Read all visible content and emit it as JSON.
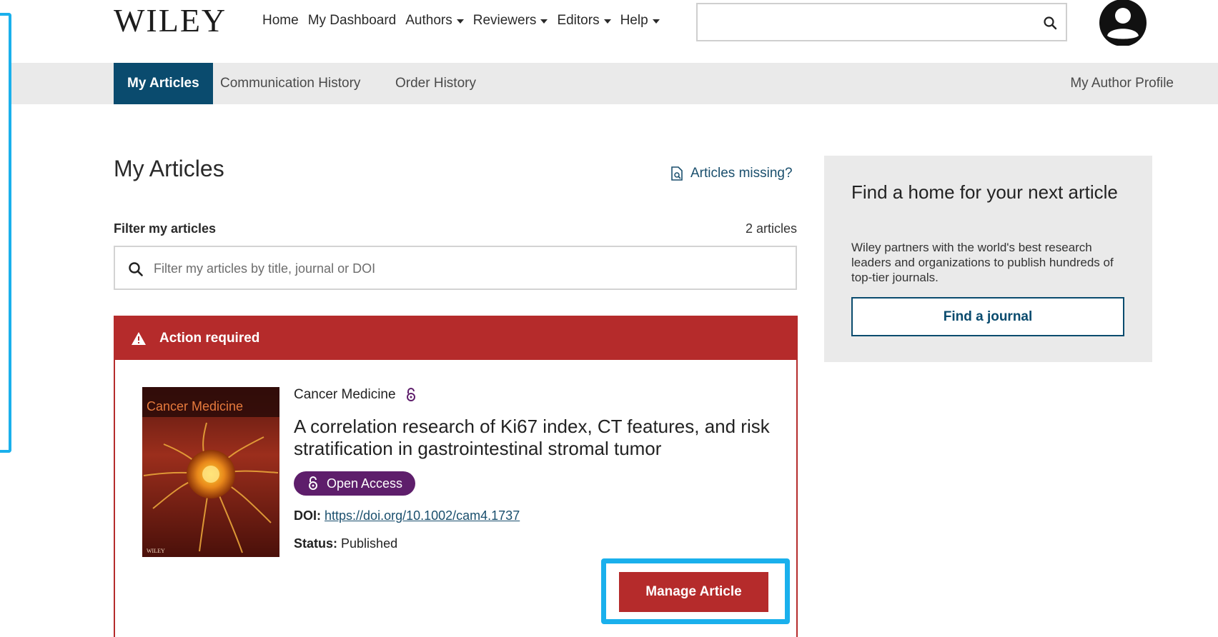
{
  "header": {
    "logo": "WILEY",
    "nav": [
      {
        "label": "Home",
        "dropdown": false
      },
      {
        "label": "My Dashboard",
        "dropdown": false
      },
      {
        "label": "Authors",
        "dropdown": true
      },
      {
        "label": "Reviewers",
        "dropdown": true
      },
      {
        "label": "Editors",
        "dropdown": true
      },
      {
        "label": "Help",
        "dropdown": true
      }
    ],
    "search": {
      "value": "",
      "placeholder": ""
    },
    "icons": {
      "search": "search-icon",
      "account": "user-avatar-icon"
    }
  },
  "subnav": {
    "tabs": [
      {
        "label": "My Articles",
        "active": true
      },
      {
        "label": "Communication History",
        "active": false
      },
      {
        "label": "Order History",
        "active": false
      }
    ],
    "profile_link": "My Author Profile"
  },
  "main": {
    "title": "My Articles",
    "missing_link": "Articles missing?",
    "filter_label": "Filter my articles",
    "article_count": "2 articles",
    "filter": {
      "value": "",
      "placeholder": "Filter my articles by title, journal or DOI"
    }
  },
  "article": {
    "alert": "Action required",
    "journal": "Cancer Medicine",
    "title": "A correlation research of Ki67 index, CT features, and risk stratification in gastrointestinal stromal tumor",
    "open_access_label": "Open Access",
    "doi_label": "DOI:",
    "doi": "https://doi.org/10.1002/cam4.1737",
    "status_label": "Status:",
    "status": "Published",
    "manage_button": "Manage Article",
    "cover": {
      "journal_name": "Cancer Medicine",
      "publisher": "WILEY"
    }
  },
  "sidebar": {
    "title": "Find a home for your next article",
    "text": "Wiley partners with the world's best research leaders and organizations to publish hundreds of top-tier journals.",
    "button": "Find a journal"
  },
  "colors": {
    "brand_blue": "#0a4b6e",
    "alert_red": "#b52b2b",
    "open_access_purple": "#5e1e6b",
    "highlight": "#1ab0ec"
  }
}
